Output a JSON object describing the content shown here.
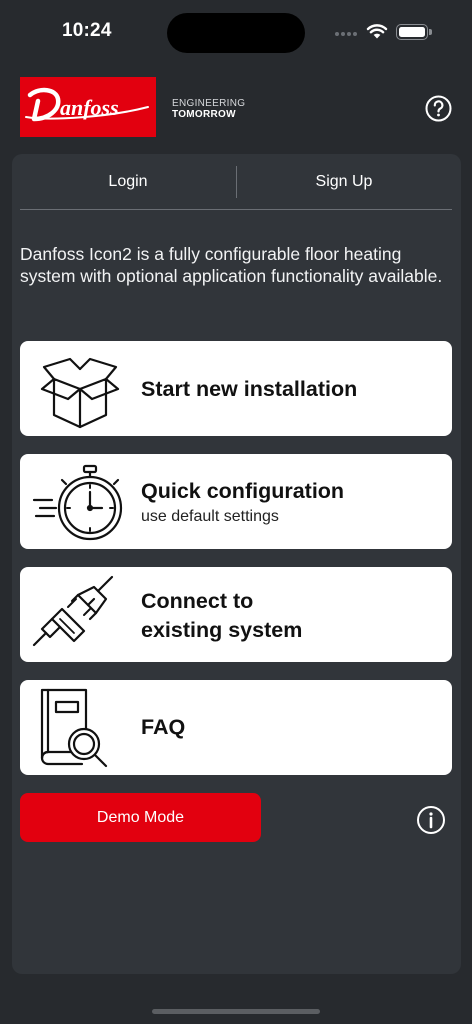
{
  "status_bar": {
    "time": "10:24"
  },
  "header": {
    "brand": "Danfoss",
    "tagline_line1": "ENGINEERING",
    "tagline_line2": "TOMORROW"
  },
  "tabs": {
    "login": "Login",
    "signup": "Sign Up"
  },
  "intro_text": "Danfoss Icon2 is a fully configurable floor heating system with optional application functionality available.",
  "options": [
    {
      "title": "Start new installation",
      "icon": "open-box-icon"
    },
    {
      "title": "Quick configuration",
      "subtitle": "use default settings",
      "icon": "stopwatch-icon"
    },
    {
      "title_line1": "Connect to",
      "title_line2": "existing system",
      "icon": "plug-connect-icon"
    },
    {
      "title": "FAQ",
      "icon": "book-search-icon"
    }
  ],
  "demo_mode_label": "Demo Mode",
  "colors": {
    "background": "#272a2e",
    "panel": "#31353a",
    "brand_red": "#e2000f",
    "card": "#ffffff"
  }
}
